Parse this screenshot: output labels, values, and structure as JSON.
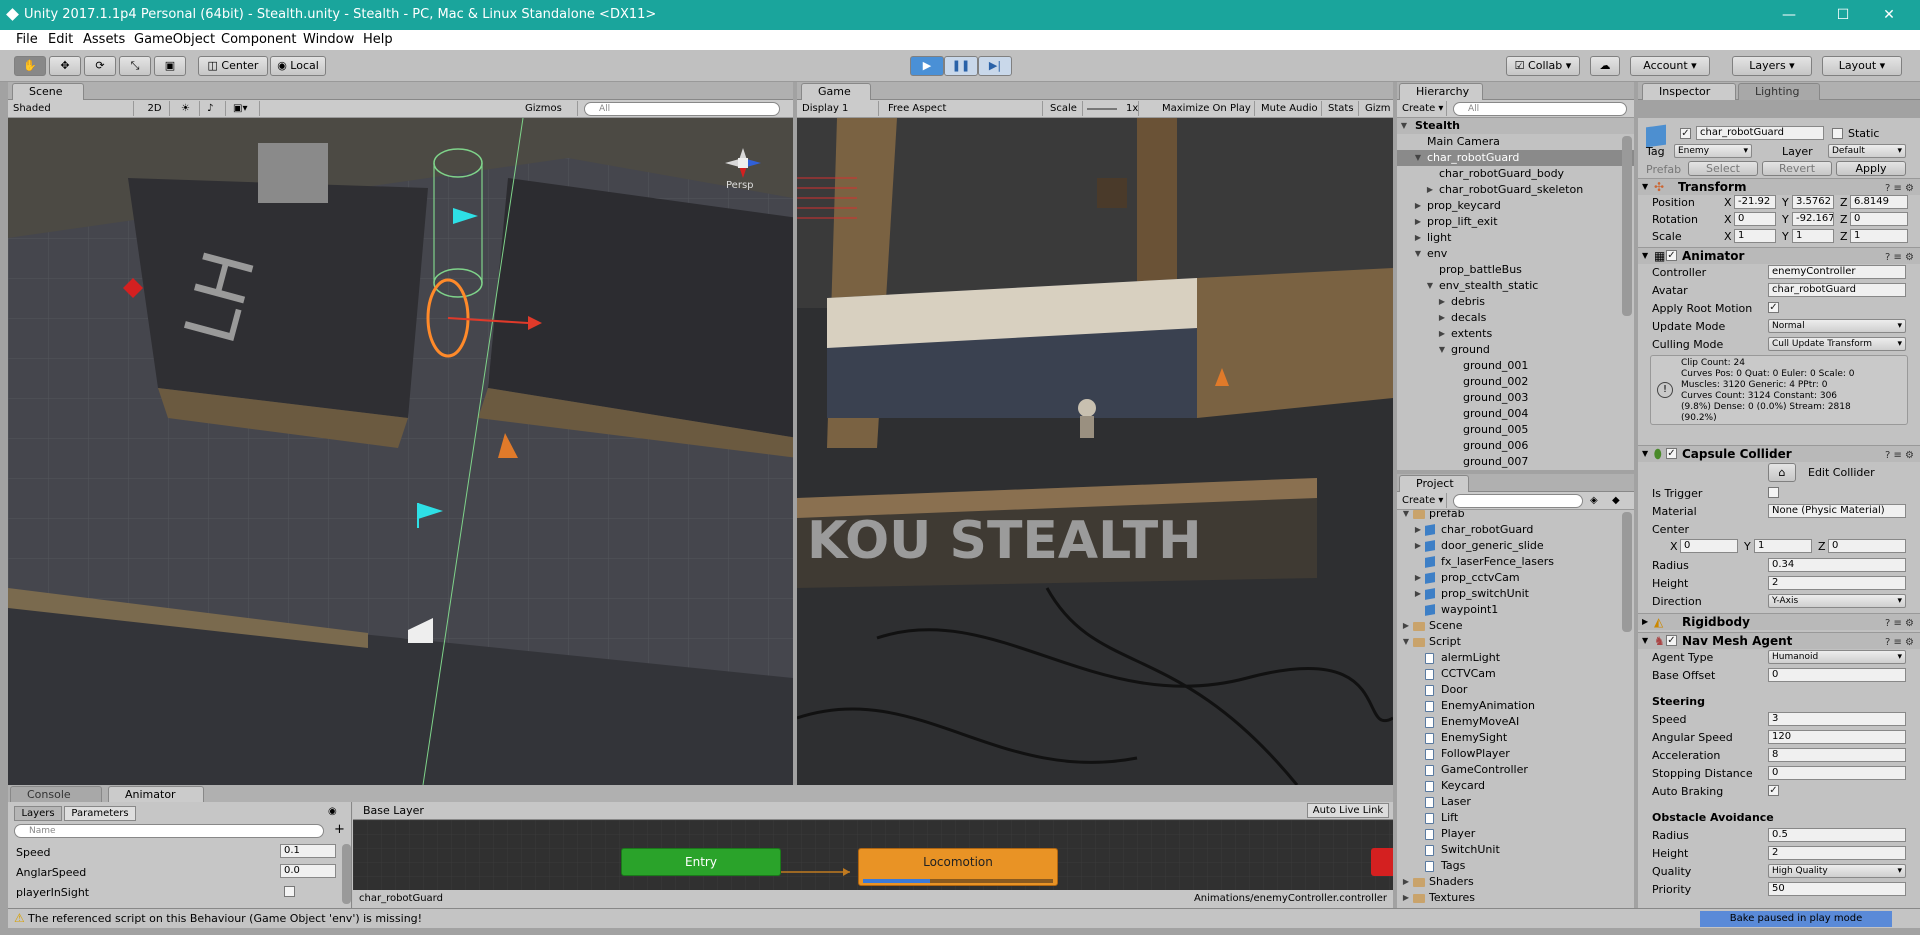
{
  "titlebar": {
    "title": "Unity 2017.1.1p4 Personal (64bit) - Stealth.unity - Stealth - PC, Mac & Linux Standalone <DX11>",
    "minimize": "—",
    "maximize": "☐",
    "close": "✕"
  },
  "menu": [
    "File",
    "Edit",
    "Assets",
    "GameObject",
    "Component",
    "Window",
    "Help"
  ],
  "toolbar": {
    "pivot": "Center",
    "space": "Local",
    "collab": "Collab",
    "account": "Account",
    "layers": "Layers",
    "layout": "Layout",
    "play": "▶",
    "pause": "❚❚",
    "step": "▶|"
  },
  "scene": {
    "tab": "Scene",
    "shading": "Shaded",
    "mode2d": "2D",
    "gizmos": "Gizmos",
    "search_placeholder": "All",
    "persp": "Persp"
  },
  "game": {
    "tab": "Game",
    "display": "Display 1",
    "aspect": "Free Aspect",
    "scale_label": "Scale",
    "scale_value": "1x",
    "maximize": "Maximize On Play",
    "mute": "Mute Audio",
    "stats": "Stats",
    "gizmos": "Gizm",
    "floor_text": "KOU STEALTH"
  },
  "hierarchy": {
    "tab": "Hierarchy",
    "create": "Create",
    "search_placeholder": "All",
    "scene": "Stealth",
    "items": [
      {
        "label": "Main Camera",
        "depth": 1,
        "arrow": ""
      },
      {
        "label": "char_robotGuard",
        "depth": 1,
        "arrow": "▼",
        "selected": true
      },
      {
        "label": "char_robotGuard_body",
        "depth": 2,
        "arrow": ""
      },
      {
        "label": "char_robotGuard_skeleton",
        "depth": 2,
        "arrow": "▶"
      },
      {
        "label": "prop_keycard",
        "depth": 1,
        "arrow": "▶"
      },
      {
        "label": "prop_lift_exit",
        "depth": 1,
        "arrow": "▶"
      },
      {
        "label": "light",
        "depth": 1,
        "arrow": "▶"
      },
      {
        "label": "env",
        "depth": 1,
        "arrow": "▼"
      },
      {
        "label": "prop_battleBus",
        "depth": 2,
        "arrow": ""
      },
      {
        "label": "env_stealth_static",
        "depth": 2,
        "arrow": "▼"
      },
      {
        "label": "debris",
        "depth": 3,
        "arrow": "▶"
      },
      {
        "label": "decals",
        "depth": 3,
        "arrow": "▶"
      },
      {
        "label": "extents",
        "depth": 3,
        "arrow": "▶"
      },
      {
        "label": "ground",
        "depth": 3,
        "arrow": "▼"
      },
      {
        "label": "ground_001",
        "depth": 4,
        "arrow": ""
      },
      {
        "label": "ground_002",
        "depth": 4,
        "arrow": ""
      },
      {
        "label": "ground_003",
        "depth": 4,
        "arrow": ""
      },
      {
        "label": "ground_004",
        "depth": 4,
        "arrow": ""
      },
      {
        "label": "ground_005",
        "depth": 4,
        "arrow": ""
      },
      {
        "label": "ground_006",
        "depth": 4,
        "arrow": ""
      },
      {
        "label": "ground_007",
        "depth": 4,
        "arrow": ""
      }
    ]
  },
  "project": {
    "tab": "Project",
    "create": "Create",
    "items": [
      {
        "label": "prefab",
        "depth": 0,
        "arrow": "▼",
        "kind": "folder"
      },
      {
        "label": "char_robotGuard",
        "depth": 1,
        "arrow": "▶",
        "kind": "prefab"
      },
      {
        "label": "door_generic_slide",
        "depth": 1,
        "arrow": "▶",
        "kind": "prefab"
      },
      {
        "label": "fx_laserFence_lasers",
        "depth": 1,
        "arrow": "",
        "kind": "prefab"
      },
      {
        "label": "prop_cctvCam",
        "depth": 1,
        "arrow": "▶",
        "kind": "prefab"
      },
      {
        "label": "prop_switchUnit",
        "depth": 1,
        "arrow": "▶",
        "kind": "prefab"
      },
      {
        "label": "waypoint1",
        "depth": 1,
        "arrow": "",
        "kind": "prefab"
      },
      {
        "label": "Scene",
        "depth": 0,
        "arrow": "▶",
        "kind": "folder"
      },
      {
        "label": "Script",
        "depth": 0,
        "arrow": "▼",
        "kind": "folder"
      },
      {
        "label": "alermLight",
        "depth": 1,
        "arrow": "",
        "kind": "script"
      },
      {
        "label": "CCTVCam",
        "depth": 1,
        "arrow": "",
        "kind": "script"
      },
      {
        "label": "Door",
        "depth": 1,
        "arrow": "",
        "kind": "script"
      },
      {
        "label": "EnemyAnimation",
        "depth": 1,
        "arrow": "",
        "kind": "script"
      },
      {
        "label": "EnemyMoveAI",
        "depth": 1,
        "arrow": "",
        "kind": "script"
      },
      {
        "label": "EnemySight",
        "depth": 1,
        "arrow": "",
        "kind": "script"
      },
      {
        "label": "FollowPlayer",
        "depth": 1,
        "arrow": "",
        "kind": "script"
      },
      {
        "label": "GameController",
        "depth": 1,
        "arrow": "",
        "kind": "script"
      },
      {
        "label": "Keycard",
        "depth": 1,
        "arrow": "",
        "kind": "script"
      },
      {
        "label": "Laser",
        "depth": 1,
        "arrow": "",
        "kind": "script"
      },
      {
        "label": "Lift",
        "depth": 1,
        "arrow": "",
        "kind": "script"
      },
      {
        "label": "Player",
        "depth": 1,
        "arrow": "",
        "kind": "script"
      },
      {
        "label": "SwitchUnit",
        "depth": 1,
        "arrow": "",
        "kind": "script"
      },
      {
        "label": "Tags",
        "depth": 1,
        "arrow": "",
        "kind": "script"
      },
      {
        "label": "Shaders",
        "depth": 0,
        "arrow": "▶",
        "kind": "folder"
      },
      {
        "label": "Textures",
        "depth": 0,
        "arrow": "▶",
        "kind": "folder"
      }
    ]
  },
  "inspector": {
    "tab": "Inspector",
    "tab2": "Lighting",
    "name": "char_robotGuard",
    "static": "Static",
    "tag_label": "Tag",
    "tag": "Enemy",
    "layer_label": "Layer",
    "layer": "Default",
    "prefab_label": "Prefab",
    "select": "Select",
    "revert": "Revert",
    "apply": "Apply",
    "transform": {
      "title": "Transform",
      "rows": [
        {
          "label": "Position",
          "x": "-21.92",
          "y": "3.5762",
          "z": "6.8149"
        },
        {
          "label": "Rotation",
          "x": "0",
          "y": "-92.167",
          "z": "0"
        },
        {
          "label": "Scale",
          "x": "1",
          "y": "1",
          "z": "1"
        }
      ]
    },
    "animator": {
      "title": "Animator",
      "controller_label": "Controller",
      "controller": "enemyController",
      "avatar_label": "Avatar",
      "avatar": "char_robotGuard",
      "root_motion_label": "Apply Root Motion",
      "update_label": "Update Mode",
      "update": "Normal",
      "culling_label": "Culling Mode",
      "culling": "Cull Update Transform",
      "info": [
        "Clip Count: 24",
        "Curves Pos: 0 Quat: 0 Euler: 0 Scale: 0",
        "Muscles: 3120 Generic: 4 PPtr: 0",
        "Curves Count: 3124 Constant: 306",
        "(9.8%) Dense: 0 (0.0%) Stream: 2818",
        "(90.2%)"
      ]
    },
    "capsule": {
      "title": "Capsule Collider",
      "edit": "Edit Collider",
      "trigger_label": "Is Trigger",
      "material_label": "Material",
      "material": "None (Physic Material)",
      "center_label": "Center",
      "cx": "0",
      "cy": "1",
      "cz": "0",
      "radius_label": "Radius",
      "radius": "0.34",
      "height_label": "Height",
      "height": "2",
      "direction_label": "Direction",
      "direction": "Y-Axis"
    },
    "rigidbody": {
      "title": "Rigidbody"
    },
    "navmesh": {
      "title": "Nav Mesh Agent",
      "agent_label": "Agent Type",
      "agent": "Humanoid",
      "offset_label": "Base Offset",
      "offset": "0",
      "steering": "Steering",
      "speed_label": "Speed",
      "speed": "3",
      "ang_label": "Angular Speed",
      "ang": "120",
      "acc_label": "Acceleration",
      "acc": "8",
      "stop_label": "Stopping Distance",
      "stop": "0",
      "brake_label": "Auto Braking",
      "obstacle": "Obstacle Avoidance",
      "oradius_label": "Radius",
      "oradius": "0.5",
      "oheight_label": "Height",
      "oheight": "2",
      "quality_label": "Quality",
      "quality": "High Quality",
      "priority_label": "Priority",
      "priority": "50"
    }
  },
  "animator_window": {
    "tab_console": "Console",
    "tab_animator": "Animator",
    "layers": "Layers",
    "parameters": "Parameters",
    "search_placeholder": "Name",
    "params": [
      {
        "name": "Speed",
        "value": "0.1"
      },
      {
        "name": "AnglarSpeed",
        "value": "0.0"
      },
      {
        "name": "playerInSight",
        "value": ""
      }
    ],
    "base_layer": "Base Layer",
    "auto_live": "Auto Live Link",
    "entry": "Entry",
    "locomotion": "Locomotion",
    "path_left": "char_robotGuard",
    "path_right": "Animations/enemyController.controller"
  },
  "status": {
    "message": "The referenced script on this Behaviour (Game Object 'env') is missing!",
    "bake": "Bake paused in play mode"
  }
}
